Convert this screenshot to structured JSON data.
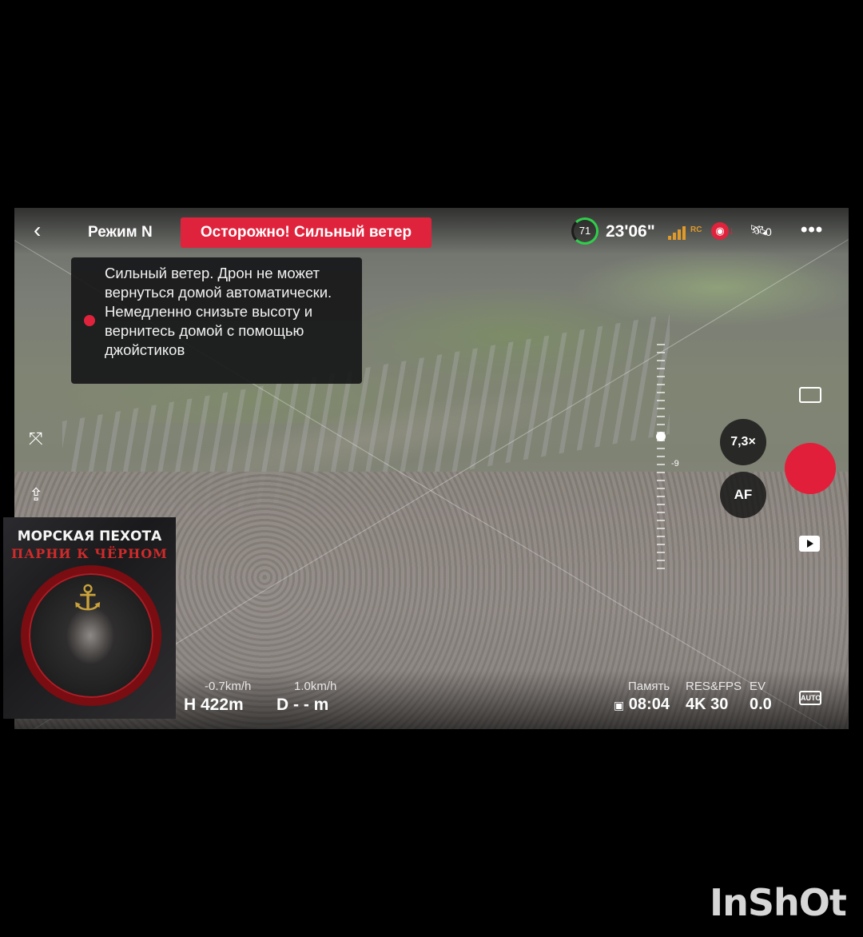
{
  "topbar": {
    "back_glyph": "‹",
    "mode_label": "Режим N",
    "warning_label": "Осторожно! Сильный ветер",
    "battery_percent": "71",
    "flight_time": "23'06\"",
    "rc_label": "RC",
    "gps_count": "0",
    "more_glyph": "•••",
    "battery_color": "#2fcf4b",
    "signal_color": "#e09a2a"
  },
  "toast": {
    "message": "Сильный ветер. Дрон не может вернуться домой автоматически. Немедленно снизьте высоту и вернитесь домой с помощью джойстиков",
    "dot_color": "#e0233c"
  },
  "camera_controls": {
    "zoom_label": "7,3×",
    "af_label": "AF",
    "scale_tick_label": "-9",
    "shutter_color": "#e21f3a"
  },
  "telemetry": {
    "vertical_speed": "-0.7km/h",
    "horizontal_speed": "1.0km/h",
    "height": "H 422m",
    "distance": "D - - m",
    "memory_label": "Память",
    "memory_value": "08:04",
    "resfps_label": "RES&FPS",
    "resfps_value": "4K 30",
    "ev_label": "EV",
    "ev_value": "0.0",
    "auto_label": "AUTO"
  },
  "icons": {
    "left_1": "track-icon",
    "left_2": "return-home-icon",
    "right_1": "photo-mode-icon",
    "right_2": "playback-icon"
  },
  "badge": {
    "title": "МОРСКАЯ ПЕХОТА",
    "subtitle": "ПАРНИ К ЧЁРНОМ"
  },
  "watermark": "InShOt"
}
